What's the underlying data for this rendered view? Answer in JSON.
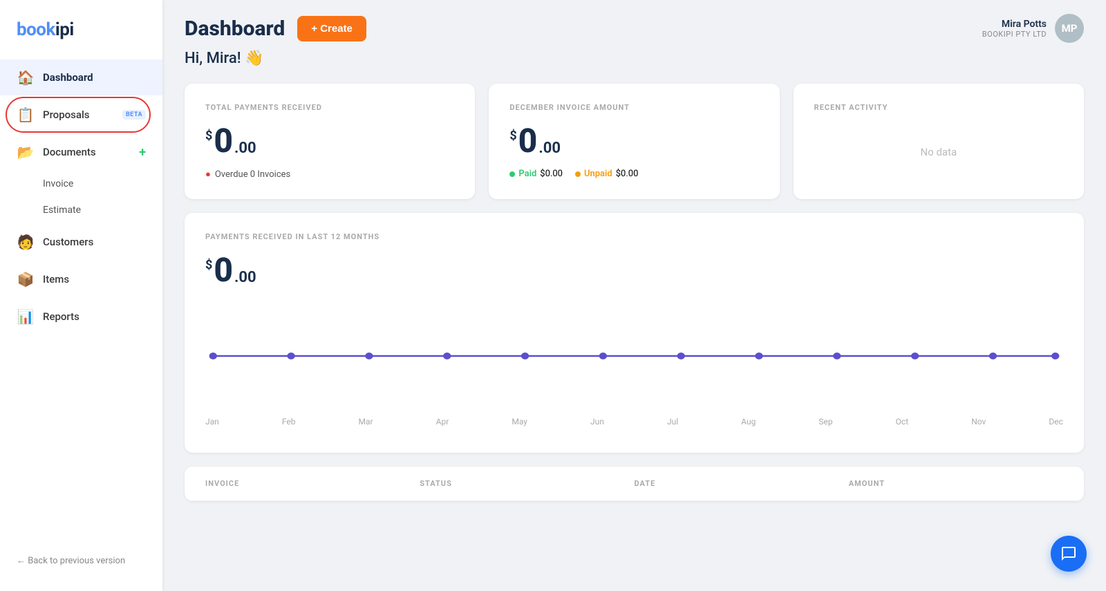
{
  "sidebar": {
    "logo": "bookipi",
    "nav_items": [
      {
        "id": "dashboard",
        "label": "Dashboard",
        "icon": "🏠",
        "active": true
      },
      {
        "id": "proposals",
        "label": "Proposals",
        "icon": "📋",
        "badge": "BETA",
        "circled": true
      },
      {
        "id": "documents",
        "label": "Documents",
        "icon": "📂",
        "add": true
      },
      {
        "id": "invoice",
        "label": "Invoice",
        "sub": true
      },
      {
        "id": "estimate",
        "label": "Estimate",
        "sub": true
      },
      {
        "id": "customers",
        "label": "Customers",
        "icon": "🧑"
      },
      {
        "id": "items",
        "label": "Items",
        "icon": "📦"
      },
      {
        "id": "reports",
        "label": "Reports",
        "icon": "📊"
      }
    ],
    "back_label": "← Back to previous version"
  },
  "topbar": {
    "page_title": "Dashboard",
    "create_btn": "+ Create",
    "user_name": "Mira Potts",
    "user_company": "BOOKIPI PTY LTD",
    "avatar_initials": "MP"
  },
  "greeting": "Hi, Mira! 👋",
  "cards": {
    "total_payments": {
      "label": "TOTAL PAYMENTS RECEIVED",
      "amount_int": "0",
      "amount_dec": ".00",
      "status_dot": "red",
      "status_text": "Overdue  0 Invoices"
    },
    "december_invoice": {
      "label": "DECEMBER INVOICE AMOUNT",
      "amount_int": "0",
      "amount_dec": ".00",
      "paid_label": "Paid",
      "paid_amount": "$0.00",
      "unpaid_label": "Unpaid",
      "unpaid_amount": "$0.00"
    },
    "recent_activity": {
      "label": "RECENT ACTIVITY",
      "empty_text": "No data"
    }
  },
  "chart": {
    "label": "PAYMENTS RECEIVED IN LAST 12 MONTHS",
    "amount_int": "0",
    "amount_dec": ".00",
    "months": [
      "Jan",
      "Feb",
      "Mar",
      "Apr",
      "May",
      "Jun",
      "Jul",
      "Aug",
      "Sep",
      "Oct",
      "Nov",
      "Dec"
    ],
    "color": "#5b4fcf"
  },
  "table": {
    "columns": [
      "INVOICE",
      "STATUS",
      "DATE",
      "AMOUNT"
    ]
  },
  "chat": {
    "icon": "chat"
  }
}
